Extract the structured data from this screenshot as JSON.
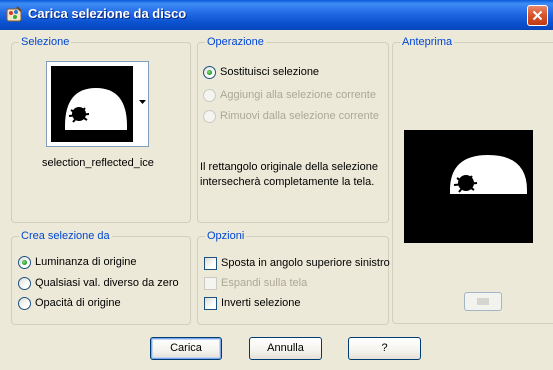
{
  "window": {
    "title": "Carica selezione da disco"
  },
  "selezione": {
    "title": "Selezione",
    "file_name": "selection_reflected_ice"
  },
  "operazione": {
    "title": "Operazione",
    "options": [
      {
        "label": "Sostituisci selezione",
        "checked": true,
        "enabled": true
      },
      {
        "label": "Aggiungi alla selezione corrente",
        "checked": false,
        "enabled": false
      },
      {
        "label": "Rimuovi dalla selezione corrente",
        "checked": false,
        "enabled": false
      }
    ],
    "description": "Il rettangolo originale della selezione intersecherà completamente la tela."
  },
  "anteprima": {
    "title": "Anteprima"
  },
  "crea_selezione": {
    "title": "Crea selezione da",
    "options": [
      {
        "label": "Luminanza di origine",
        "checked": true
      },
      {
        "label": "Qualsiasi val. diverso da zero",
        "checked": false
      },
      {
        "label": "Opacità di origine",
        "checked": false
      }
    ]
  },
  "opzioni": {
    "title": "Opzioni",
    "options": [
      {
        "label": "Sposta in angolo superiore sinistro",
        "checked": false,
        "enabled": true
      },
      {
        "label": "Espandi sulla tela",
        "checked": false,
        "enabled": false
      },
      {
        "label": "Inverti selezione",
        "checked": false,
        "enabled": true
      }
    ]
  },
  "buttons": {
    "ok": "Carica",
    "cancel": "Annulla",
    "help": "?"
  },
  "colors": {
    "title_bar": "#0A52CF",
    "group_title": "#0046D5",
    "dialog_bg": "#ECE9D8",
    "disabled_text": "#ACA899"
  }
}
